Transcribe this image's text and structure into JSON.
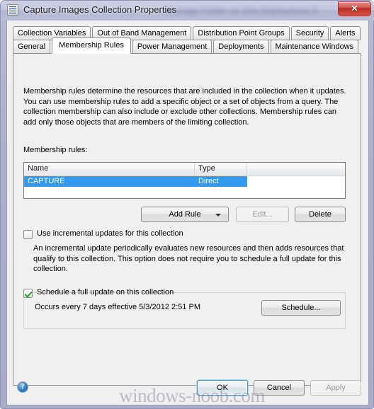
{
  "window": {
    "title": "Capture Images Collection Properties",
    "title_blurred_suffix": "Manage Folder on Site        Deployment S",
    "icon": "properties-document-icon",
    "close_glyph": "✕"
  },
  "tabs": {
    "row1": [
      {
        "label": "Collection Variables",
        "selected": false
      },
      {
        "label": "Out of Band Management",
        "selected": false
      },
      {
        "label": "Distribution Point Groups",
        "selected": false
      },
      {
        "label": "Security",
        "selected": false
      },
      {
        "label": "Alerts",
        "selected": false
      }
    ],
    "row2": [
      {
        "label": "General",
        "selected": false
      },
      {
        "label": "Membership Rules",
        "selected": true
      },
      {
        "label": "Power Management",
        "selected": false
      },
      {
        "label": "Deployments",
        "selected": false
      },
      {
        "label": "Maintenance Windows",
        "selected": false
      }
    ]
  },
  "page": {
    "description": "Membership rules determine the resources that are included in the collection when it updates. You can use membership rules to add a specific object or a set of objects from a query. The collection membership can also include or exclude other collections. Membership rules can add only those objects that are members of the limiting collection.",
    "rules_label": "Membership rules:",
    "list": {
      "columns": [
        "Name",
        "Type",
        ""
      ],
      "rows": [
        {
          "name": "CAPTURE",
          "type": "Direct",
          "selected": true
        }
      ]
    },
    "buttons": {
      "add_rule": "Add Rule",
      "edit": "Edit...",
      "delete": "Delete",
      "schedule": "Schedule..."
    },
    "incremental": {
      "checkbox_label": "Use incremental updates for this collection",
      "checked": false,
      "description": "An incremental update periodically evaluates new resources and then adds resources that qualify to this collection. This option does not require you to schedule a full update for this collection."
    },
    "full_update": {
      "checkbox_label": "Schedule a full update on this collection",
      "checked": true,
      "occurs_text": "Occurs every 7 days effective 5/3/2012 2:51 PM"
    }
  },
  "footer": {
    "help": "?",
    "ok": "OK",
    "cancel": "Cancel",
    "apply": "Apply"
  },
  "watermark": "windows-noob.com",
  "colors": {
    "selection_blue": "#3399ef",
    "close_red": "#bc2a21",
    "frame": "#adb0cb",
    "dialog_bg": "#f0f0f0"
  }
}
